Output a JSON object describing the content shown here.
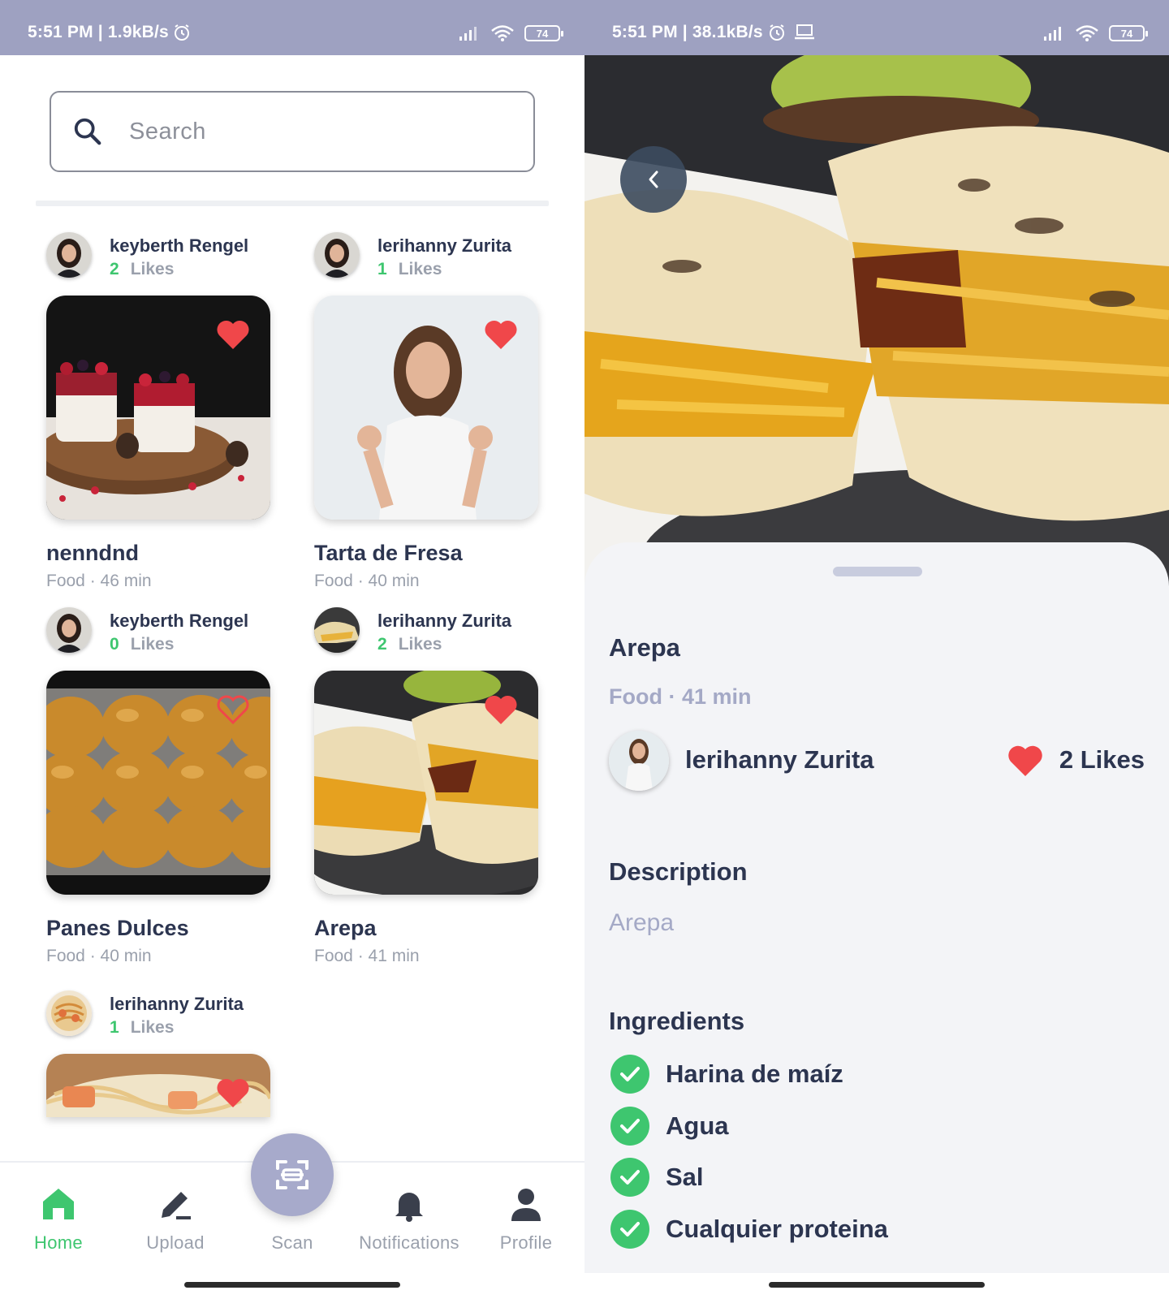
{
  "left_status": {
    "time": "5:51 PM | 1.9kB/s",
    "battery": "74"
  },
  "right_status": {
    "time": "5:51 PM | 38.1kB/s",
    "battery": "74"
  },
  "search": {
    "placeholder": "Search"
  },
  "posts": [
    {
      "author": "keyberth Rengel",
      "likes_count": "2",
      "likes_label": "Likes",
      "title": "nenndnd",
      "meta": "Food · 46 min",
      "liked": true,
      "image": "parfait-dessert-photo"
    },
    {
      "author": "lerihanny Zurita",
      "likes_count": "1",
      "likes_label": "Likes",
      "title": "Tarta de Fresa",
      "meta": "Food · 40 min",
      "liked": true,
      "image": "woman-portrait-photo"
    },
    {
      "author": "keyberth Rengel",
      "likes_count": "0",
      "likes_label": "Likes",
      "title": "Panes Dulces",
      "meta": "Food · 40 min",
      "liked": false,
      "image": "sweet-bread-rolls-photo"
    },
    {
      "author": "lerihanny Zurita",
      "likes_count": "2",
      "likes_label": "Likes",
      "title": "Arepa",
      "meta": "Food · 41 min",
      "liked": true,
      "image": "arepa-photo"
    },
    {
      "author": "lerihanny Zurita",
      "likes_count": "1",
      "likes_label": "Likes",
      "title": "",
      "meta": "",
      "liked": true,
      "image": "pasta-photo"
    }
  ],
  "nav": {
    "home": "Home",
    "upload": "Upload",
    "scan": "Scan",
    "notifications": "Notifications",
    "profile": "Profile"
  },
  "detail": {
    "title": "Arepa",
    "meta": "Food · 41 min",
    "author": "lerihanny Zurita",
    "likes": "2 Likes",
    "description_heading": "Description",
    "description": "Arepa",
    "ingredients_heading": "Ingredients",
    "ingredients": [
      "Harina de maíz",
      "Agua",
      "Sal",
      "Cualquier proteina"
    ]
  },
  "colors": {
    "accent_green": "#3ec66f",
    "heart_red": "#f0474a",
    "status_bar": "#9ea1c1",
    "dark_text": "#2c3550",
    "muted_text": "#9aa0ac"
  }
}
